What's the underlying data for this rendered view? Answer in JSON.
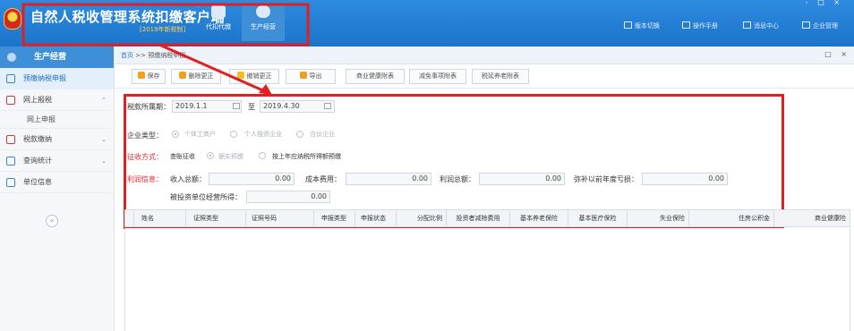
{
  "header": {
    "title": "自然人税收管理系统扣缴客户端",
    "version": "[2019年新税制]",
    "modes": [
      "代扣代缴",
      "生产经营"
    ],
    "links": [
      "版本切换",
      "操作手册",
      "消息中心",
      "企业管理"
    ],
    "window_controls": "- □ ×"
  },
  "sidebar": {
    "header": "生产经营",
    "items": [
      {
        "label": "预缴纳税申报"
      },
      {
        "label": "网上报税",
        "arrow": "⌃"
      },
      {
        "label": "网上申报"
      },
      {
        "label": "税款缴纳",
        "arrow": "⌄"
      },
      {
        "label": "查询统计",
        "arrow": "⌄"
      },
      {
        "label": "单位信息"
      }
    ],
    "collapse_glyph": "«"
  },
  "breadcrumb": {
    "home": "首页",
    "separator": ">>",
    "current": "预缴纳税申报",
    "controls": "□ ×"
  },
  "toolbar": {
    "buttons": [
      "保存",
      "删除更正",
      "撤销更正",
      "导出",
      "商业健康附表",
      "减免事项附表",
      "税延养老附表"
    ]
  },
  "form": {
    "period_label": "税款所属期：",
    "period_start": "2019.1.1",
    "period_to": "至",
    "period_end": "2019.4.30",
    "enterprise_type_label": "企业类型：",
    "enterprise_types": [
      "个体工商户",
      "个人独资企业",
      "合伙企业"
    ],
    "levy_label": "征收方式：",
    "levy_value": "查账征收",
    "levy_options": [
      "据实预缴",
      "按上年应纳税所得额预缴"
    ],
    "profit_label": "利润信息：",
    "income_label": "收入总额：",
    "income_value": "0.00",
    "cost_label": "成本费用：",
    "cost_value": "0.00",
    "profit_total_label": "利润总额：",
    "profit_total_value": "0.00",
    "loss_label": "弥补以前年度亏损：",
    "loss_value": "0.00",
    "invested_label": "被投资单位经营所得：",
    "invested_value": "0.00"
  },
  "grid": {
    "columns": [
      "姓名",
      "证照类型",
      "证照号码",
      "申报类型",
      "申报状态",
      "分配比例",
      "投资者减除费用",
      "基本养老保险",
      "基本医疗保险",
      "失业保险",
      "住房公积金",
      "商业健康险"
    ]
  },
  "colors": {
    "banner": "#1f78cc",
    "annotation_red": "#e01f22",
    "sidebar_active": "#e3effb"
  }
}
